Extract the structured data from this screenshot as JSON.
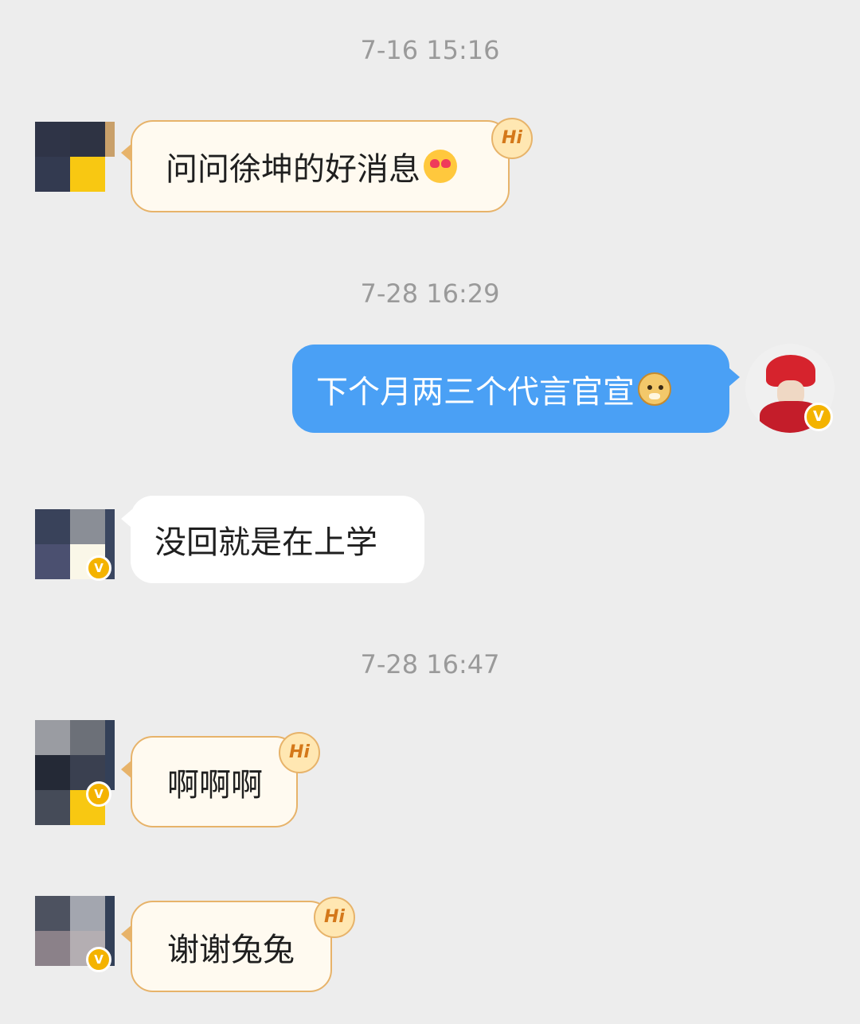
{
  "timestamps": [
    "7-16 15:16",
    "7-28 16:29",
    "7-28 16:47"
  ],
  "messages": [
    {
      "sender": "other",
      "text": "问问徐坤的好消息",
      "emoji": "heart-eyes-emoji",
      "tag": "Hi"
    },
    {
      "sender": "me",
      "text": "下个月两三个代言官宣",
      "emoji": "doge-emoji"
    },
    {
      "sender": "other",
      "text": "没回就是在上学"
    },
    {
      "sender": "other",
      "text": "啊啊啊",
      "tag": "Hi"
    },
    {
      "sender": "other",
      "text": "谢谢兔兔",
      "tag": "Hi"
    }
  ],
  "badge": "V",
  "colors": {
    "background": "#ededed",
    "timestamp": "#9a9a9a",
    "my_bubble": "#4aa0f5",
    "hi_bubble": "#fffaf0",
    "hi_border": "#e7b36a",
    "verified_badge": "#f4b300"
  },
  "icons": [
    "heart-eyes-emoji",
    "doge-emoji",
    "verified-badge-icon",
    "hi-tag-icon"
  ]
}
